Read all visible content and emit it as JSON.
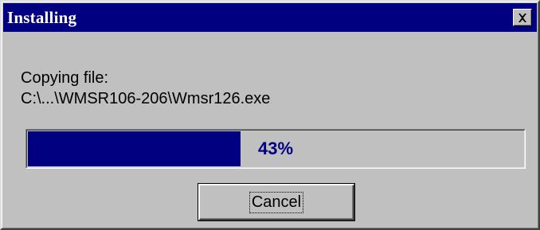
{
  "window": {
    "title": "Installing",
    "close_glyph": "close-icon"
  },
  "status": {
    "heading": "Copying file:",
    "file_path": "C:\\...\\WMSR106-206\\Wmsr126.exe"
  },
  "progress": {
    "value": 0.43,
    "label": "43%"
  },
  "buttons": {
    "cancel_label": "Cancel"
  },
  "colors": {
    "titlebar": "#000080",
    "face": "#c0c0c0",
    "progress_fill": "#000080",
    "progress_text": "#000080"
  }
}
